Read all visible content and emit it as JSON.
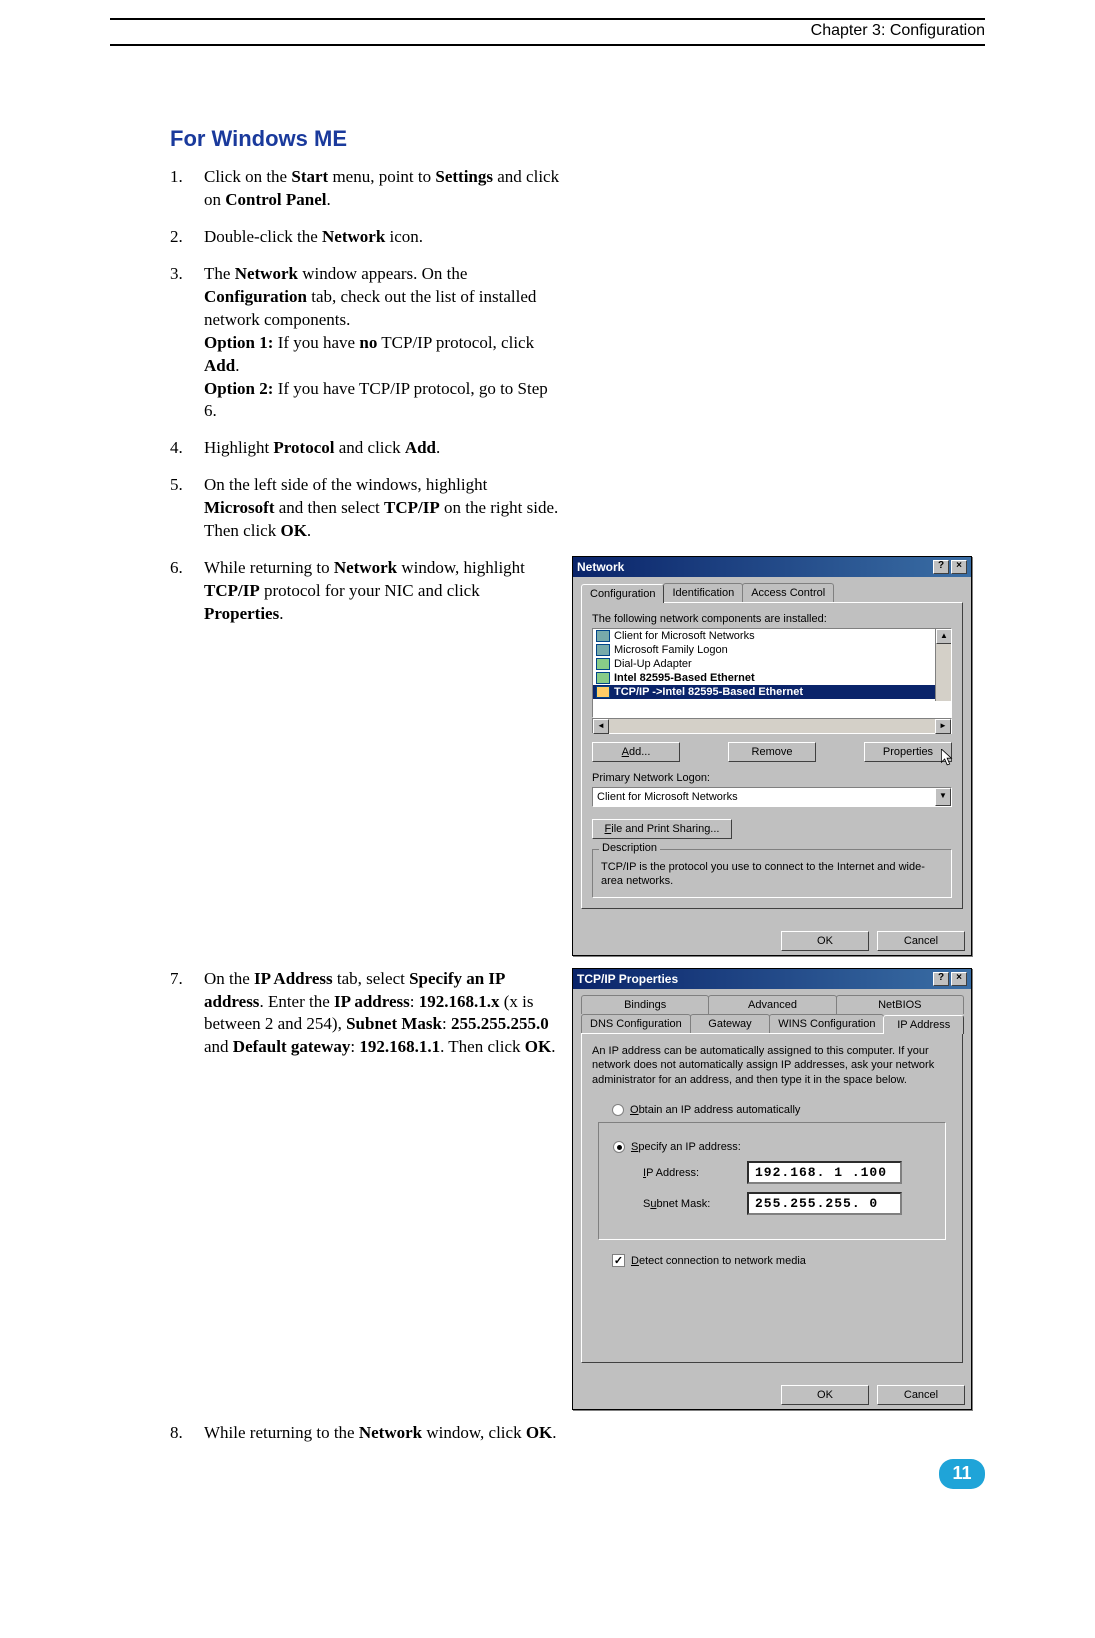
{
  "header": {
    "chapter": "Chapter 3: Configuration"
  },
  "section_title": "For Windows ME",
  "steps": {
    "s1_num": "1.",
    "s1_pre": "Click on the ",
    "s1_b1": "Start",
    "s1_mid1": " menu, point to ",
    "s1_b2": "Settings",
    "s1_mid2": " and click on ",
    "s1_b3": "Control Panel",
    "s1_end": ".",
    "s2_num": "2.",
    "s2_pre": "Double-click the ",
    "s2_b1": "Network",
    "s2_end": " icon.",
    "s3_num": "3.",
    "s3_pre": "The ",
    "s3_b1": "Network",
    "s3_mid1": " window appears. On the ",
    "s3_b2": "Configuration",
    "s3_mid2": " tab, check out the list of installed network components.",
    "s3_br1_b": "Option 1:",
    "s3_br1_t1": " If you have ",
    "s3_br1_b2": "no",
    "s3_br1_t2": " TCP/IP protocol, click ",
    "s3_br1_b3": "Add",
    "s3_br1_end": ".",
    "s3_br2_b": "Option 2:",
    "s3_br2_t": " If you have TCP/IP protocol, go to Step 6.",
    "s4_num": "4.",
    "s4_pre": "Highlight ",
    "s4_b1": "Protocol",
    "s4_mid": " and click ",
    "s4_b2": "Add",
    "s4_end": ".",
    "s5_num": "5.",
    "s5_pre": "On the left side of the windows, highlight ",
    "s5_b1": "Microsoft",
    "s5_mid": " and then select ",
    "s5_b2": "TCP/IP",
    "s5_mid2": " on the right side. Then click ",
    "s5_b3": "OK",
    "s5_end": ".",
    "s6_num": "6.",
    "s6_pre": "While returning to ",
    "s6_b1": "Network",
    "s6_mid": " window, highlight ",
    "s6_b2": "TCP/IP",
    "s6_mid2": " protocol for your NIC and click ",
    "s6_b3": "Properties",
    "s6_end": ".",
    "s7_num": "7.",
    "s7_pre": "On the ",
    "s7_b1": "IP Address",
    "s7_mid1": " tab, select ",
    "s7_b2": "Specify an IP address",
    "s7_mid2": ". Enter the ",
    "s7_b3": "IP address",
    "s7_mid3": ": ",
    "s7_b4": "192.168.1.x",
    "s7_mid4": " (x is between 2 and 254), ",
    "s7_b5": "Subnet Mask",
    "s7_mid5": ": ",
    "s7_b6": "255.255.255.0",
    "s7_mid6": " and ",
    "s7_b7": "Default gateway",
    "s7_mid7": ": ",
    "s7_b8": "192.168.1.1",
    "s7_mid8": ". Then click ",
    "s7_b9": "OK",
    "s7_end": ".",
    "s8_num": "8.",
    "s8_pre": "While returning to the ",
    "s8_b1": "Network",
    "s8_mid": " window, click ",
    "s8_b2": "OK",
    "s8_end": "."
  },
  "dlg1": {
    "title": "Network",
    "tab1": "Configuration",
    "tab2": "Identification",
    "tab3": "Access Control",
    "list_label": "The following network components are installed:",
    "items": [
      "Client for Microsoft Networks",
      "Microsoft Family Logon",
      "Dial-Up Adapter",
      "Intel 82595-Based Ethernet",
      "TCP/IP ->Intel 82595-Based Ethernet"
    ],
    "btn_add": "Add...",
    "btn_remove": "Remove",
    "btn_props": "Properties",
    "logon_label": "Primary Network Logon:",
    "logon_value": "Client for Microsoft Networks",
    "fps_btn": "File and Print Sharing...",
    "desc_title": "Description",
    "desc_text": "TCP/IP is the protocol you use to connect to the Internet and wide-area networks.",
    "ok": "OK",
    "cancel": "Cancel"
  },
  "dlg2": {
    "title": "TCP/IP Properties",
    "tabs_row1": [
      "Bindings",
      "Advanced",
      "NetBIOS"
    ],
    "tabs_row2": [
      "DNS Configuration",
      "Gateway",
      "WINS Configuration",
      "IP Address"
    ],
    "info": "An IP address can be automatically assigned to this computer. If your network does not automatically assign IP addresses, ask your network administrator for an address, and then type it in the space below.",
    "radio_auto_u": "O",
    "radio_auto": "btain an IP address automatically",
    "radio_spec_u": "S",
    "radio_spec": "pecify an IP address:",
    "ip_label_u": "I",
    "ip_label": "P Address:",
    "ip_value": "192.168. 1  .100",
    "mask_label": "S",
    "mask_label_u": "u",
    "mask_label2": "bnet Mask:",
    "mask_value": "255.255.255. 0",
    "detect_u": "D",
    "detect": "etect connection to network media",
    "ok": "OK",
    "cancel": "Cancel"
  },
  "page_number": "11"
}
